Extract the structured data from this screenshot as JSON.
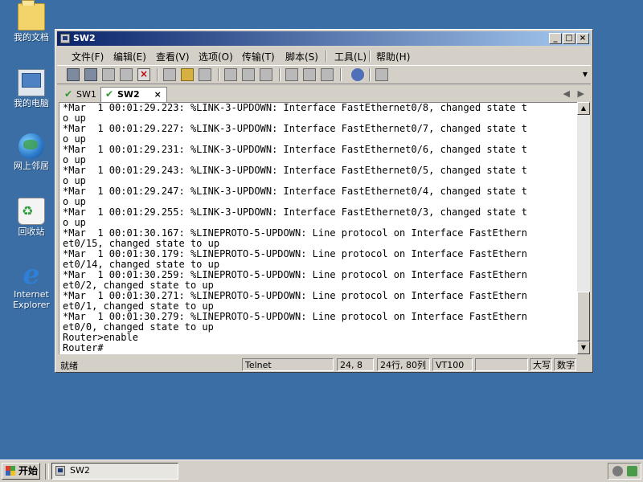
{
  "desktop": {
    "icons": [
      {
        "label": "我的文档",
        "icon": "my-documents-folder-icon"
      },
      {
        "label": "我的电脑",
        "icon": "my-computer-icon"
      },
      {
        "label": "网上邻居",
        "icon": "network-places-icon"
      },
      {
        "label": "回收站",
        "icon": "recycle-bin-icon"
      },
      {
        "label": "Internet Explorer",
        "icon": "internet-explorer-icon"
      }
    ]
  },
  "window": {
    "title": "SW2",
    "controls": [
      "minimize",
      "maximize",
      "close"
    ],
    "menu": [
      {
        "label": "文件(F)"
      },
      {
        "label": "编辑(E)"
      },
      {
        "label": "查看(V)"
      },
      {
        "label": "选项(O)"
      },
      {
        "label": "传输(T)"
      },
      {
        "label": "脚本(S)"
      },
      {
        "label": "工具(L)"
      },
      {
        "label": "帮助(H)"
      }
    ],
    "tabs": [
      {
        "label": "SW1",
        "active": false
      },
      {
        "label": "SW2",
        "active": true
      }
    ],
    "tab_close": "×",
    "terminal": {
      "lines": [
        "*Mar  1 00:01:29.223: %LINK-3-UPDOWN: Interface FastEthernet0/8, changed state t",
        "o up",
        "*Mar  1 00:01:29.227: %LINK-3-UPDOWN: Interface FastEthernet0/7, changed state t",
        "o up",
        "*Mar  1 00:01:29.231: %LINK-3-UPDOWN: Interface FastEthernet0/6, changed state t",
        "o up",
        "*Mar  1 00:01:29.243: %LINK-3-UPDOWN: Interface FastEthernet0/5, changed state t",
        "o up",
        "*Mar  1 00:01:29.247: %LINK-3-UPDOWN: Interface FastEthernet0/4, changed state t",
        "o up",
        "*Mar  1 00:01:29.255: %LINK-3-UPDOWN: Interface FastEthernet0/3, changed state t",
        "o up",
        "*Mar  1 00:01:30.167: %LINEPROTO-5-UPDOWN: Line protocol on Interface FastEthern",
        "et0/15, changed state to up",
        "*Mar  1 00:01:30.179: %LINEPROTO-5-UPDOWN: Line protocol on Interface FastEthern",
        "et0/14, changed state to up",
        "*Mar  1 00:01:30.259: %LINEPROTO-5-UPDOWN: Line protocol on Interface FastEthern",
        "et0/2, changed state to up",
        "*Mar  1 00:01:30.271: %LINEPROTO-5-UPDOWN: Line protocol on Interface FastEthern",
        "et0/1, changed state to up",
        "*Mar  1 00:01:30.279: %LINEPROTO-5-UPDOWN: Line protocol on Interface FastEthern",
        "et0/0, changed state to up",
        "Router>enable",
        "Router#"
      ]
    },
    "status": {
      "ready": "就绪",
      "protocol": "Telnet",
      "cursor": "24,  8",
      "size": "24行, 80列",
      "emulation": "VT100",
      "caps": "大写",
      "num": "数字"
    }
  },
  "taskbar": {
    "start_label": "开始",
    "task_label": "SW2"
  }
}
